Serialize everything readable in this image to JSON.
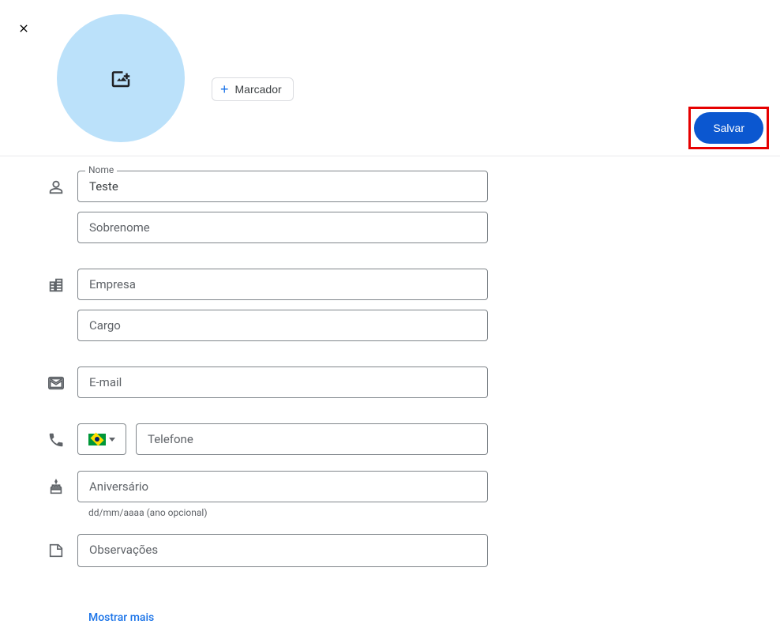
{
  "actions": {
    "close_label": "Fechar",
    "marker_label": "Marcador",
    "save_label": "Salvar"
  },
  "fields": {
    "name_label": "Nome",
    "name_value": "Teste",
    "surname_placeholder": "Sobrenome",
    "company_placeholder": "Empresa",
    "jobtitle_placeholder": "Cargo",
    "email_placeholder": "E-mail",
    "phone_placeholder": "Telefone",
    "phone_country": "BR",
    "birthday_placeholder": "Aniversário",
    "birthday_helper": "dd/mm/aaaa (ano opcional)",
    "notes_placeholder": "Observações"
  },
  "footer": {
    "show_more_label": "Mostrar mais"
  }
}
